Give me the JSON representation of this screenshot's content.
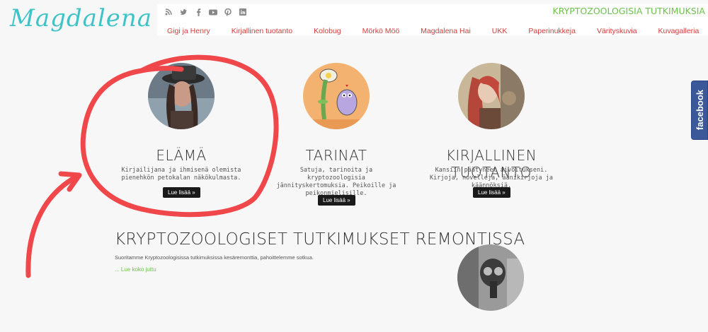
{
  "logo": "Magdalena Hai",
  "tagline": "KRYPTOZOOLOGISIA TUTKIMUKSIA",
  "social": [
    {
      "name": "rss",
      "glyph": "☰"
    },
    {
      "name": "twitter",
      "glyph": "t"
    },
    {
      "name": "facebook",
      "glyph": "f"
    },
    {
      "name": "youtube",
      "glyph": "▶"
    },
    {
      "name": "pinterest",
      "glyph": "P"
    },
    {
      "name": "linkedin",
      "glyph": "in"
    }
  ],
  "nav": [
    "Gigi ja Henry",
    "Kirjallinen tuotanto",
    "Kolobug",
    "Mörkö Möö",
    "Magdalena Hai",
    "UKK",
    "Paperinukkeja",
    "Värityskuvia",
    "Kuvagalleria"
  ],
  "facebook_tab": "facebook",
  "columns": [
    {
      "title": "ELÄMÄ",
      "text": "Kirjailijana ja ihmisenä olemista pienehkön petokalan näkökulmasta.",
      "button": "Lue lisää »"
    },
    {
      "title": "TARINAT",
      "text": "Satuja, tarinoita ja kryptozoologisia jännityskertomuksia. Peikoille ja peikonmielisille.",
      "button": "Lue lisää »"
    },
    {
      "title": "KIRJALLINEN TUOTANTO",
      "text": "Kansiin päätyneet aivoitukseni. Kirjoja, novelleja, äänikirjoja ja käännöksiä.",
      "button": "Lue lisää »"
    }
  ],
  "post": {
    "title": "KRYPTOZOOLOGISET TUTKIMUKSET REMONTISSA",
    "excerpt": "Suoritamme Kryptozoologisissa tutkimuksissa kesäremonttia, pahoittelemme sotkua.",
    "more": "... Lue koko juttu"
  },
  "colors": {
    "accent_green": "#6cc24a",
    "nav_red": "#d63b3b",
    "logo_teal": "#3ec3c7",
    "annotation": "#f0474b"
  }
}
